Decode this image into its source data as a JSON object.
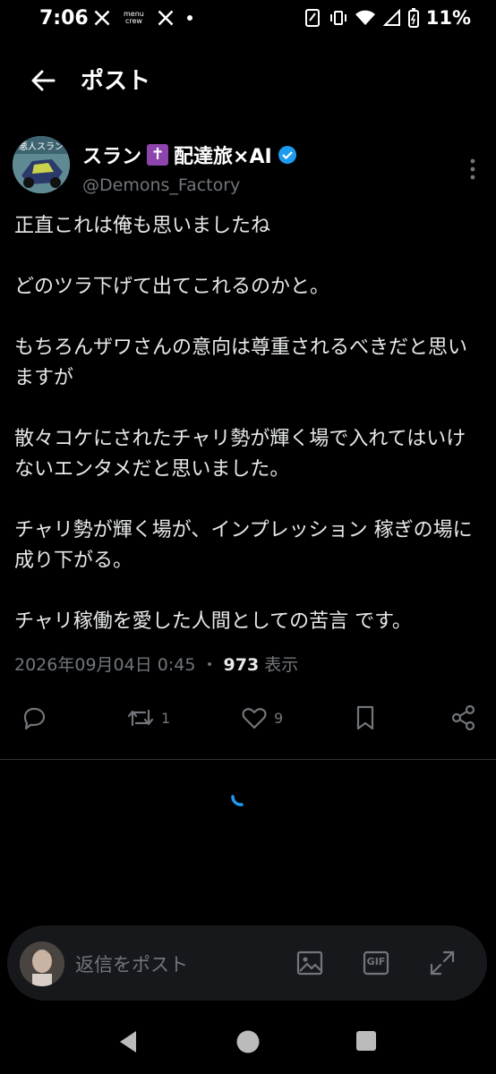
{
  "status": {
    "time": "7:06",
    "menu_crew": [
      "menu",
      "crew"
    ],
    "battery": "11%"
  },
  "header": {
    "title": "ポスト"
  },
  "tweet": {
    "avatar_text": "悪人スラン",
    "display_name": "スラン",
    "display_name_suffix": "配達旅×AI",
    "cross_emoji": "✝",
    "handle": "@Demons_Factory",
    "text": "正直これは俺も思いましたね\n\nどのツラ下げて出てこれるのかと。\n\nもちろんザワさんの意向は尊重されるべきだと思いますが\n\n散々コケにされたチャリ勢が輝く場で入れてはいけないエンタメだと思いました。\n\nチャリ勢が輝く場が、インプレッション 稼ぎの場に成り下がる。\n\nチャリ稼働を愛した人間としての苦言 です。",
    "timestamp": "2026年09月04日 0:45",
    "separator": "・",
    "views_count": "973",
    "views_label": "表示",
    "retweets": "1",
    "likes": "9"
  },
  "reply": {
    "placeholder": "返信をポスト",
    "gif_label": "GIF"
  },
  "colors": {
    "background": "#000000",
    "text": "#e7e9ea",
    "secondary": "#71767b",
    "accent": "#1d9bf0",
    "cross_bg": "#8e44ad"
  },
  "icons": {
    "back": "arrow-left-icon",
    "verified": "verified-badge-icon",
    "more": "more-vertical-icon",
    "reply": "comment-icon",
    "retweet": "retweet-icon",
    "like": "heart-icon",
    "bookmark": "bookmark-icon",
    "share": "share-icon",
    "image": "image-icon",
    "gif": "gif-icon",
    "expand": "expand-icon"
  }
}
